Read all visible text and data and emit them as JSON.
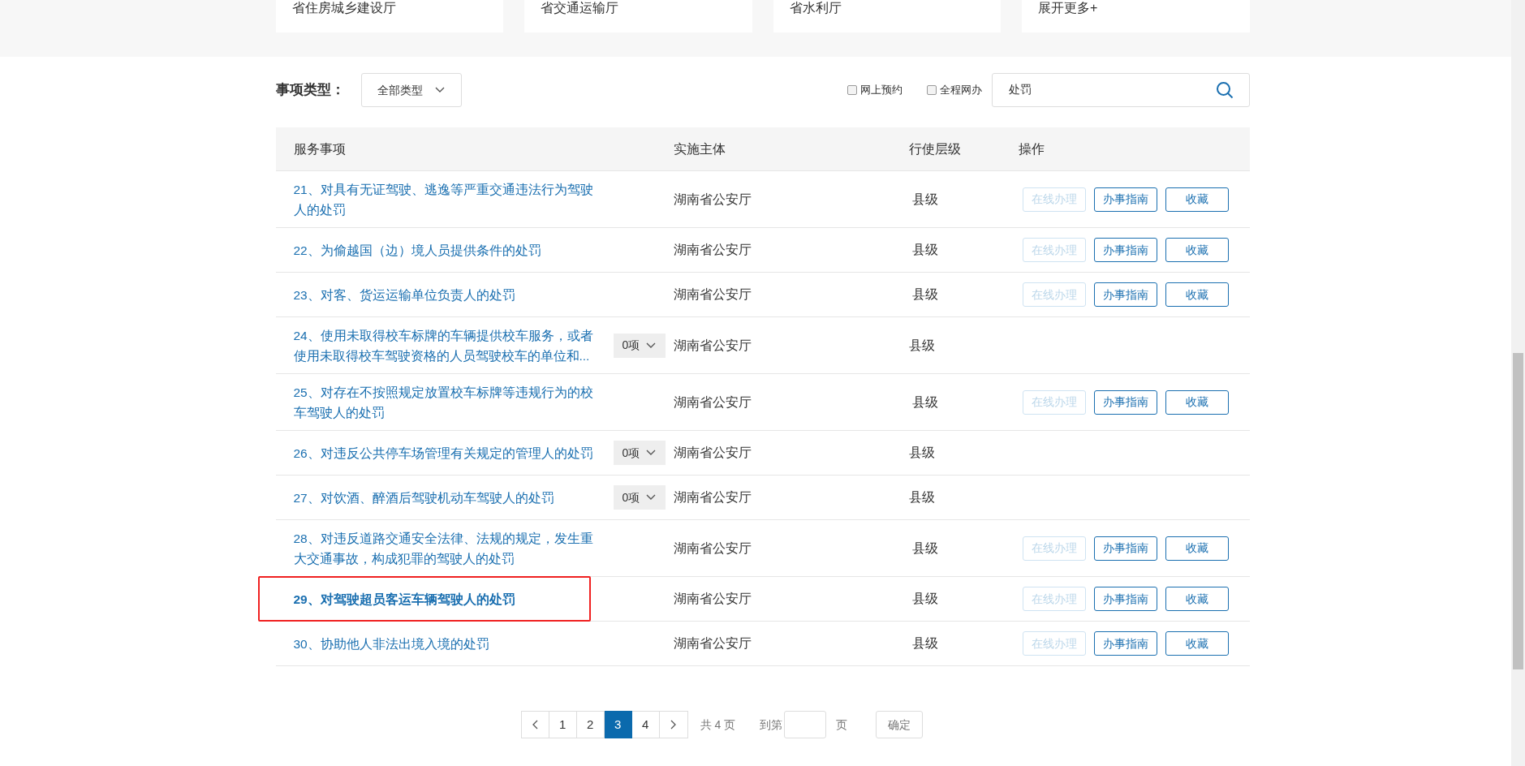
{
  "departments": [
    {
      "label": "省住房城乡建设厅"
    },
    {
      "label": "省交通运输厅"
    },
    {
      "label": "省水利厅"
    },
    {
      "label": "展开更多+"
    }
  ],
  "filter": {
    "label": "事项类型：",
    "type_select": "全部类型",
    "checkboxes": [
      {
        "label": "网上预约",
        "checked": false
      },
      {
        "label": "全程网办",
        "checked": false
      }
    ],
    "search": {
      "value": "处罚"
    }
  },
  "table": {
    "columns": [
      "服务事项",
      "实施主体",
      "行使层级",
      "操作"
    ],
    "rows": [
      {
        "kind": "actions",
        "name": "21、对具有无证驾驶、逃逸等严重交通违法行为驾驶人的处罚",
        "agency": "湖南省公安厅",
        "level_text": "县级",
        "highlighted": false,
        "actions": [
          {
            "label": "在线办理",
            "disabled": true
          },
          {
            "label": "办事指南",
            "disabled": false
          },
          {
            "label": "收藏",
            "disabled": false
          }
        ]
      },
      {
        "kind": "actions",
        "name": "22、为偷越国（边）境人员提供条件的处罚",
        "agency": "湖南省公安厅",
        "level_text": "县级",
        "highlighted": false,
        "actions": [
          {
            "label": "在线办理",
            "disabled": true
          },
          {
            "label": "办事指南",
            "disabled": false
          },
          {
            "label": "收藏",
            "disabled": false
          }
        ]
      },
      {
        "kind": "actions",
        "name": "23、对客、货运运输单位负责人的处罚",
        "agency": "湖南省公安厅",
        "level_text": "县级",
        "highlighted": false,
        "actions": [
          {
            "label": "在线办理",
            "disabled": true
          },
          {
            "label": "办事指南",
            "disabled": false
          },
          {
            "label": "收藏",
            "disabled": false
          }
        ]
      },
      {
        "kind": "dropdown",
        "name": "24、使用未取得校车标牌的车辆提供校车服务，或者使用未取得校车驾驶资格的人员驾驶校车的单位和...",
        "count": "0项",
        "agency": "湖南省公安厅",
        "level_text": "县级",
        "highlighted": false
      },
      {
        "kind": "actions",
        "name": "25、对存在不按照规定放置校车标牌等违规行为的校车驾驶人的处罚",
        "agency": "湖南省公安厅",
        "level_text": "县级",
        "highlighted": false,
        "actions": [
          {
            "label": "在线办理",
            "disabled": true
          },
          {
            "label": "办事指南",
            "disabled": false
          },
          {
            "label": "收藏",
            "disabled": false
          }
        ]
      },
      {
        "kind": "dropdown",
        "name": "26、对违反公共停车场管理有关规定的管理人的处罚",
        "count": "0项",
        "agency": "湖南省公安厅",
        "level_text": "县级",
        "highlighted": false
      },
      {
        "kind": "dropdown",
        "name": "27、对饮酒、醉酒后驾驶机动车驾驶人的处罚",
        "count": "0项",
        "agency": "湖南省公安厅",
        "level_text": "县级",
        "highlighted": false
      },
      {
        "kind": "actions",
        "name": "28、对违反道路交通安全法律、法规的规定，发生重大交通事故，构成犯罪的驾驶人的处罚",
        "agency": "湖南省公安厅",
        "level_text": "县级",
        "highlighted": false,
        "actions": [
          {
            "label": "在线办理",
            "disabled": true
          },
          {
            "label": "办事指南",
            "disabled": false
          },
          {
            "label": "收藏",
            "disabled": false
          }
        ]
      },
      {
        "kind": "actions",
        "name": "29、对驾驶超员客运车辆驾驶人的处罚",
        "agency": "湖南省公安厅",
        "level_text": "县级",
        "highlighted": true,
        "actions": [
          {
            "label": "在线办理",
            "disabled": true
          },
          {
            "label": "办事指南",
            "disabled": false
          },
          {
            "label": "收藏",
            "disabled": false
          }
        ]
      },
      {
        "kind": "actions",
        "name": "30、协助他人非法出境入境的处罚",
        "agency": "湖南省公安厅",
        "level_text": "县级",
        "highlighted": false,
        "actions": [
          {
            "label": "在线办理",
            "disabled": true
          },
          {
            "label": "办事指南",
            "disabled": false
          },
          {
            "label": "收藏",
            "disabled": false
          }
        ]
      }
    ]
  },
  "pagination": {
    "pages": [
      {
        "label": "1",
        "selected": false
      },
      {
        "label": "2",
        "selected": false
      },
      {
        "label": "3",
        "selected": true
      },
      {
        "label": "4",
        "selected": false
      }
    ],
    "total": "共 4 页",
    "goto_label": "到第",
    "page_unit": "页",
    "confirm": "确定"
  }
}
